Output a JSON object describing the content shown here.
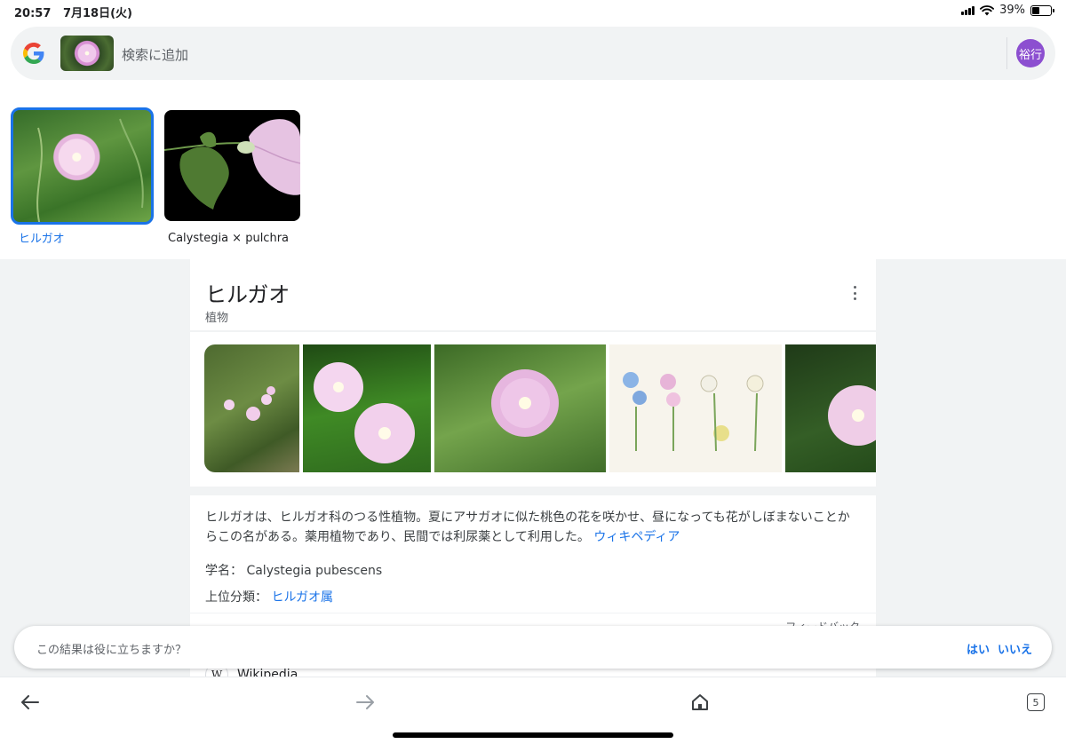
{
  "status_bar": {
    "time": "20:57",
    "date": "7月18日(火)",
    "battery": "39%",
    "battery_level": 0.39
  },
  "search": {
    "placeholder": "検索に追加",
    "avatar_initials": "裕行",
    "avatar_color": "#8c4fd0"
  },
  "candidates": [
    {
      "label": "ヒルガオ",
      "selected": true
    },
    {
      "label": "Calystegia × pulchra",
      "selected": false
    }
  ],
  "knowledge_panel": {
    "title": "ヒルガオ",
    "subtitle": "植物",
    "description": "ヒルガオは、ヒルガオ科のつる性植物。夏にアサガオに似た桃色の花を咲かせ、昼になっても花がしぼまないことからこの名がある。薬用植物であり、民間では利尿薬として利用した。",
    "source_link": "ウィキペディア",
    "facts": [
      {
        "label": "学名：",
        "value": "Calystegia pubescens",
        "is_link": false
      },
      {
        "label": "上位分類：",
        "value": "ヒルガオ属",
        "is_link": true
      }
    ],
    "feedback_label": "フィードバック",
    "wiki_label": "Wikipedia",
    "wiki_logo": "W"
  },
  "feedback_prompt": {
    "question": "この結果は役に立ちますか？",
    "yes": "はい",
    "no": "いいえ"
  },
  "bottom_nav": {
    "tab_count": "5"
  },
  "colors": {
    "accent": "#1a73e8",
    "panel_bg": "#f1f3f4"
  }
}
